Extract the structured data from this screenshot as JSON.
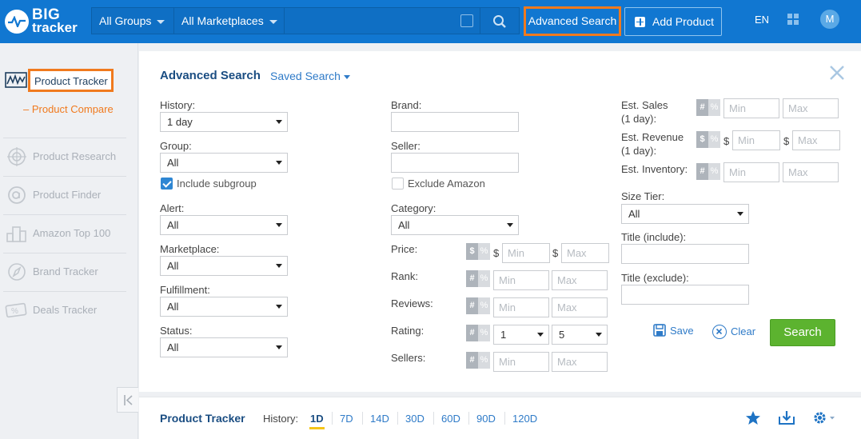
{
  "brand": {
    "line1": "BIG",
    "line2": "tracker"
  },
  "topbar": {
    "group_select": "All Groups",
    "marketplace_select": "All Marketplaces",
    "search_value": "",
    "advanced_search": "Advanced Search",
    "add_product": "Add Product",
    "language": "EN",
    "avatar_initial": "M"
  },
  "sidebar": {
    "product_tracker": "Product Tracker",
    "product_compare": "– Product Compare",
    "items": [
      {
        "label": "Product Research",
        "icon": "target-icon"
      },
      {
        "label": "Product Finder",
        "icon": "finder-icon"
      },
      {
        "label": "Amazon Top 100",
        "icon": "podium-icon"
      },
      {
        "label": "Brand Tracker",
        "icon": "compass-icon"
      },
      {
        "label": "Deals Tracker",
        "icon": "percent-tag-icon"
      }
    ]
  },
  "advanced": {
    "title": "Advanced Search",
    "saved_search": "Saved Search",
    "history": {
      "label": "History:",
      "value": "1 day"
    },
    "group": {
      "label": "Group:",
      "value": "All"
    },
    "include_subgroup": {
      "label": "Include subgroup",
      "checked": true
    },
    "alert": {
      "label": "Alert:",
      "value": "All"
    },
    "marketplace": {
      "label": "Marketplace:",
      "value": "All"
    },
    "fulfillment": {
      "label": "Fulfillment:",
      "value": "All"
    },
    "status": {
      "label": "Status:",
      "value": "All"
    },
    "brand": {
      "label": "Brand:",
      "value": ""
    },
    "seller": {
      "label": "Seller:",
      "value": ""
    },
    "exclude_amazon": {
      "label": "Exclude Amazon",
      "checked": false
    },
    "category": {
      "label": "Category:",
      "value": "All"
    },
    "price": {
      "label": "Price:",
      "currency": "$",
      "min_placeholder": "Min",
      "max_placeholder": "Max"
    },
    "rank": {
      "label": "Rank:",
      "min_placeholder": "Min",
      "max_placeholder": "Max"
    },
    "reviews": {
      "label": "Reviews:",
      "min_placeholder": "Min",
      "max_placeholder": "Max"
    },
    "rating": {
      "label": "Rating:",
      "min_value": "1",
      "max_value": "5"
    },
    "sellers": {
      "label": "Sellers:",
      "min_placeholder": "Min",
      "max_placeholder": "Max"
    },
    "est_sales": {
      "label1": "Est. Sales",
      "label2": "(1 day):",
      "min_placeholder": "Min",
      "max_placeholder": "Max"
    },
    "est_revenue": {
      "label1": "Est. Revenue",
      "label2": "(1 day):",
      "currency": "$",
      "min_placeholder": "Min",
      "max_placeholder": "Max"
    },
    "est_inventory": {
      "label": "Est. Inventory:",
      "min_placeholder": "Min",
      "max_placeholder": "Max"
    },
    "size_tier": {
      "label": "Size Tier:",
      "value": "All"
    },
    "title_include": {
      "label": "Title (include):",
      "value": ""
    },
    "title_exclude": {
      "label": "Title (exclude):",
      "value": ""
    },
    "toggle": {
      "hash": "#",
      "percent": "%",
      "dollar": "$"
    },
    "save": "Save",
    "clear": "Clear",
    "search": "Search"
  },
  "bottom": {
    "title": "Product Tracker",
    "history_label": "History:",
    "tabs": [
      "1D",
      "7D",
      "14D",
      "30D",
      "60D",
      "90D",
      "120D"
    ],
    "active_tab": "1D"
  },
  "colors": {
    "brand_blue": "#1177d1",
    "highlight_orange": "#f07a1e",
    "search_green": "#5cb32f",
    "link_blue": "#2f7bc8"
  }
}
